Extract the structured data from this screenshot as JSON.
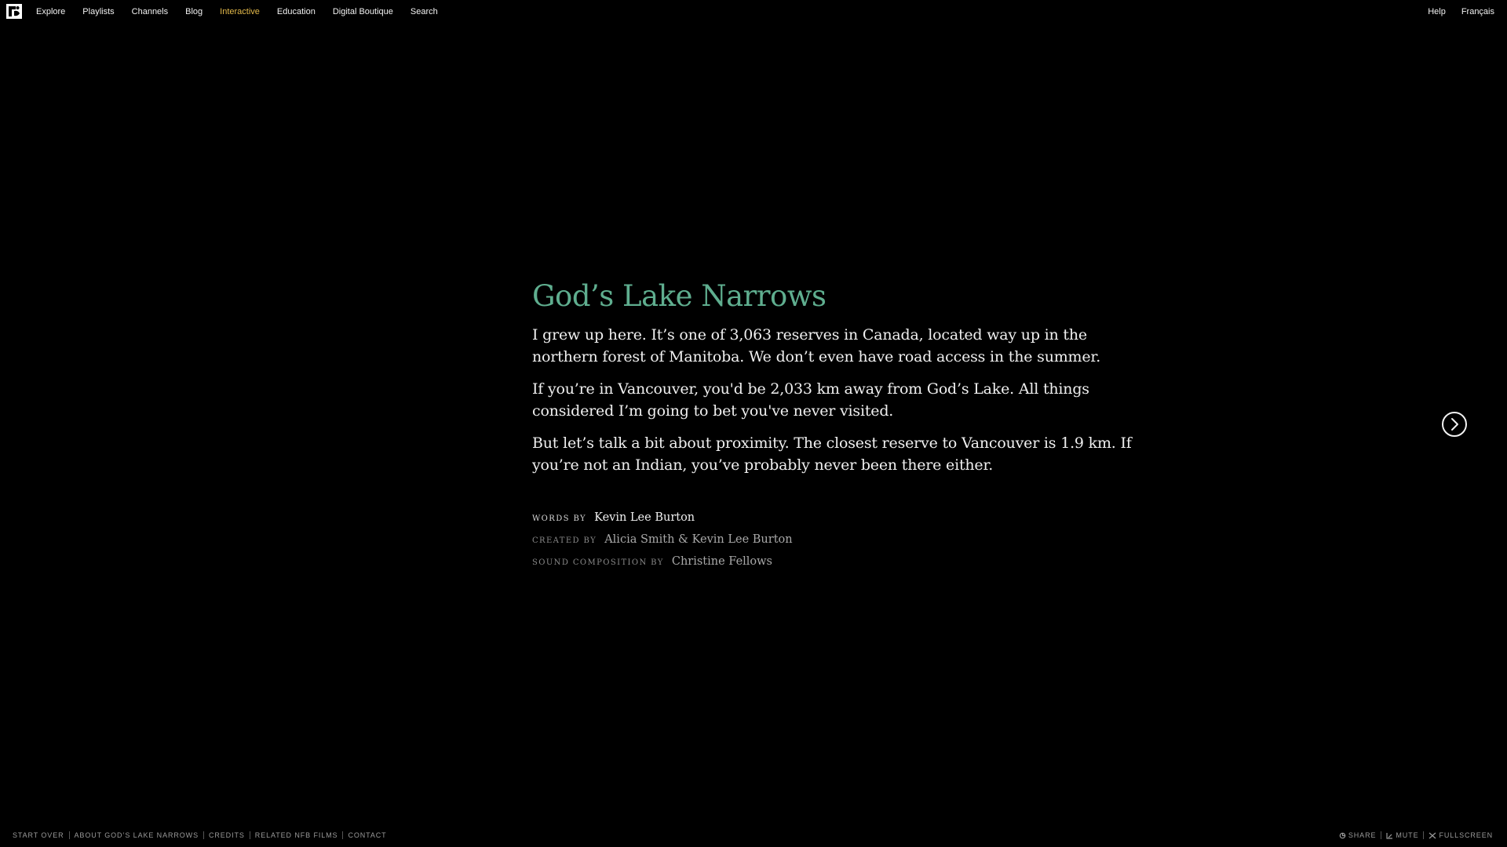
{
  "nav": {
    "left": [
      {
        "label": "Explore",
        "active": false
      },
      {
        "label": "Playlists",
        "active": false
      },
      {
        "label": "Channels",
        "active": false
      },
      {
        "label": "Blog",
        "active": false
      },
      {
        "label": "Interactive",
        "active": true
      },
      {
        "label": "Education",
        "active": false
      },
      {
        "label": "Digital Boutique",
        "active": false
      },
      {
        "label": "Search",
        "active": false
      }
    ],
    "right": [
      {
        "label": "Help"
      },
      {
        "label": "Français"
      }
    ]
  },
  "story": {
    "title": "God’s Lake Narrows",
    "paragraphs": [
      "I grew up here. It’s one of 3,063 reserves in Canada, located way up in the northern forest of Manitoba. We don’t even have road access in the summer.",
      "If you’re in Vancouver, you'd be 2,033 km away from God’s Lake. All things considered I’m going to bet you've never visited.",
      "But let’s talk a bit about proximity. The closest reserve to Vancouver is 1.9 km. If you’re not an Indian, you’ve probably never been there either."
    ],
    "credits": [
      {
        "label": "words by",
        "name": "Kevin Lee Burton"
      },
      {
        "label": "created by",
        "name": "Alicia Smith & Kevin Lee Burton"
      },
      {
        "label": "sound composition by",
        "name": "Christine Fellows"
      }
    ]
  },
  "footer": {
    "links": [
      "START OVER",
      "ABOUT GOD’S LAKE NARROWS",
      "CREDITS",
      "RELATED NFB FILMS",
      "CONTACT"
    ],
    "tools": [
      {
        "label": "SHARE",
        "icon": "share-icon"
      },
      {
        "label": "MUTE",
        "icon": "volume-icon"
      },
      {
        "label": "FULLSCREEN",
        "icon": "fullscreen-icon"
      }
    ]
  },
  "colors": {
    "background": "#000000",
    "title": "#5fae8f",
    "nav_active": "#e3b94a"
  }
}
